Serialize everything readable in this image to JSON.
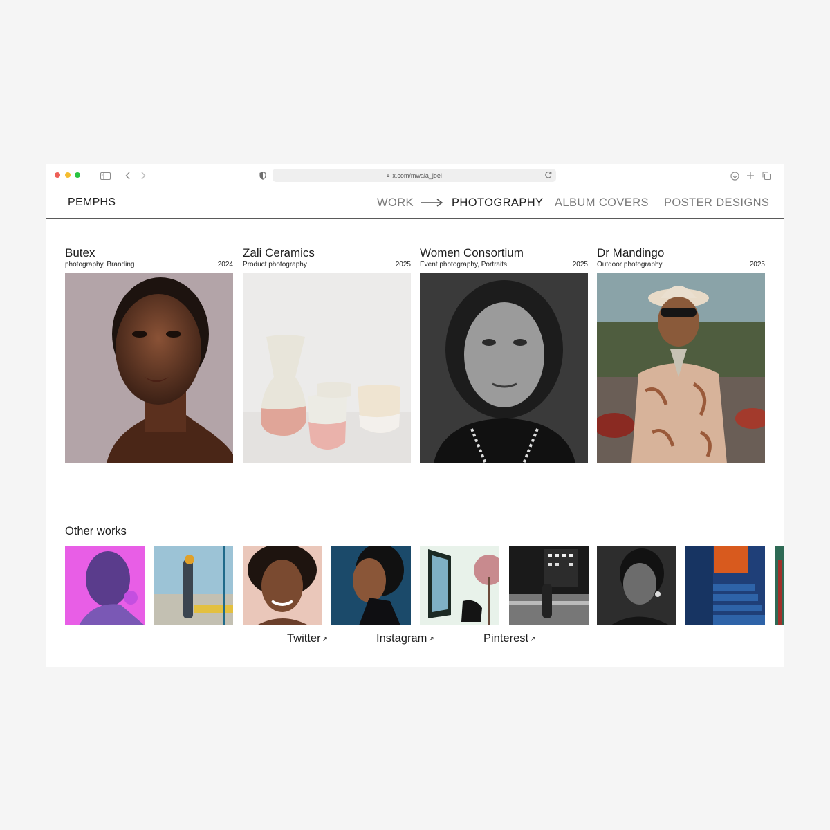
{
  "browser": {
    "url": "x.com/mwala_joel"
  },
  "header": {
    "logo": "PEMPHS",
    "nav": [
      {
        "label": "WORK",
        "active": false
      },
      {
        "label": "PHOTOGRAPHY",
        "active": true
      },
      {
        "label": "ALBUM COVERS",
        "active": false
      },
      {
        "label": "POSTER DESIGNS",
        "active": false
      }
    ]
  },
  "projects": [
    {
      "title": "Butex",
      "category": "photography, Branding",
      "year": "2024"
    },
    {
      "title": "Zali Ceramics",
      "category": "Product photography",
      "year": "2025"
    },
    {
      "title": "Women Consortium",
      "category": "Event photography, Portraits",
      "year": "2025"
    },
    {
      "title": "Dr Mandingo",
      "category": "Outdoor photography",
      "year": "2025"
    }
  ],
  "other_works": {
    "title": "Other works"
  },
  "social": [
    {
      "label": "Twitter",
      "icon": "external-arrow-icon"
    },
    {
      "label": "Instagram",
      "icon": "external-arrow-icon"
    },
    {
      "label": "Pinterest",
      "icon": "external-arrow-icon"
    }
  ],
  "colors": {
    "background": "#f5f5f5",
    "window": "#ffffff",
    "active_nav": "#1d1d1d",
    "inactive_nav": "#7a7a7a"
  }
}
